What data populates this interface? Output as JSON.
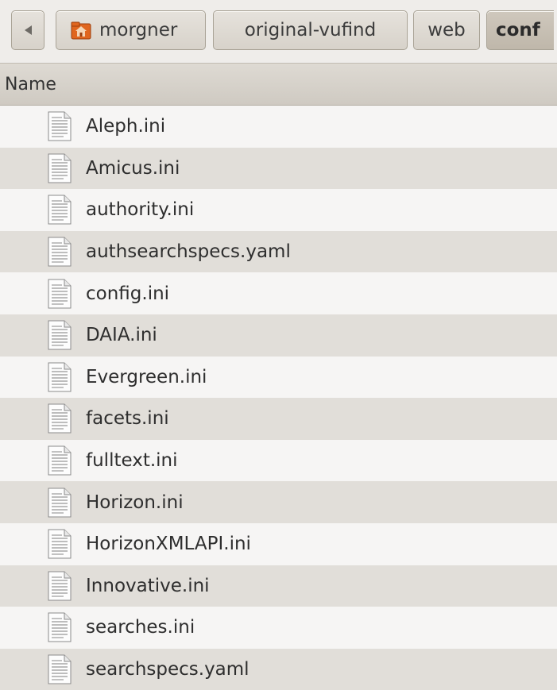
{
  "pathbar": {
    "crumbs": [
      "morgner",
      "original-vufind",
      "web",
      "conf"
    ]
  },
  "header": {
    "name_label": "Name"
  },
  "files": [
    "Aleph.ini",
    "Amicus.ini",
    "authority.ini",
    "authsearchspecs.yaml",
    "config.ini",
    "DAIA.ini",
    "Evergreen.ini",
    "facets.ini",
    "fulltext.ini",
    "Horizon.ini",
    "HorizonXMLAPI.ini",
    "Innovative.ini",
    "searches.ini",
    "searchspecs.yaml"
  ],
  "icons": {
    "back": "left-arrow-icon",
    "home": "home-folder-icon",
    "file": "text-document-icon"
  }
}
